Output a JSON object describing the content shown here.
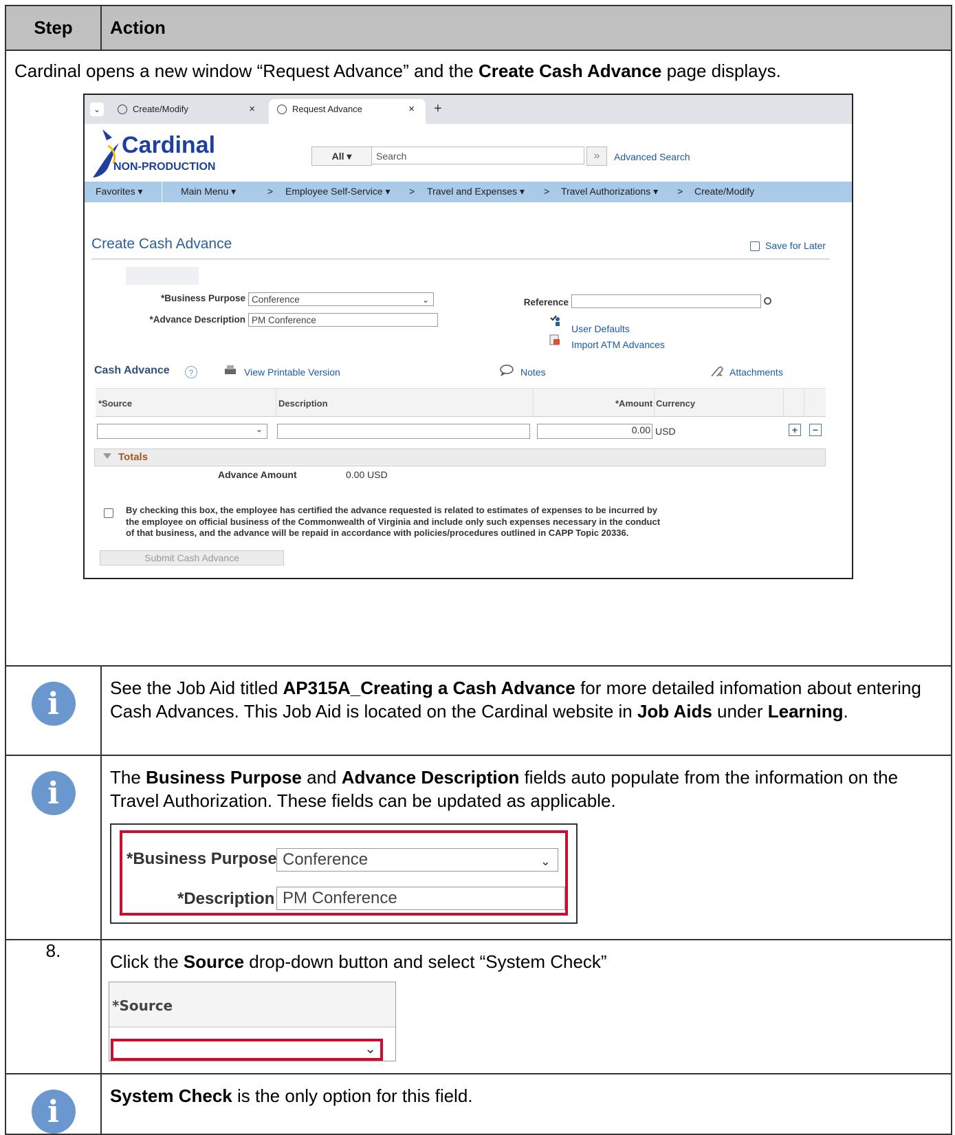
{
  "table": {
    "header_step": "Step",
    "header_action": "Action"
  },
  "intro": {
    "text_1": "Cardinal opens a new window “Request Advance” and the ",
    "bold_1": "Create Cash Advance",
    "text_2": " page displays."
  },
  "browser": {
    "tab_1": "Create/Modify",
    "tab_2": "Request Advance",
    "tab_close": "×",
    "new_tab": "+",
    "logo_main": "Cardinal",
    "logo_sub": "NON-PRODUCTION",
    "search_scope": "All",
    "search_placeholder": "Search",
    "advanced_search": "Advanced Search",
    "nav": {
      "favorites": "Favorites ▾",
      "main_menu": "Main Menu ▾",
      "employee_self_service": "Employee Self-Service ▾",
      "travel_expenses": "Travel and Expenses ▾",
      "travel_authorizations": "Travel Authorizations ▾",
      "create_modify": "Create/Modify",
      "separator": ">"
    }
  },
  "form": {
    "page_title": "Create Cash Advance",
    "save_for_later": "Save for Later",
    "business_purpose_label": "*Business Purpose",
    "business_purpose_value": "Conference",
    "advance_description_label": "*Advance Description",
    "advance_description_value": "PM Conference",
    "reference_label": "Reference",
    "reference_value": "",
    "user_defaults": "User Defaults",
    "import_atm": "Import ATM Advances",
    "section_title": "Cash Advance",
    "help": "?",
    "view_printable": "View Printable Version",
    "notes": "Notes",
    "attachments": "Attachments",
    "grid": {
      "col_source": "*Source",
      "col_description": "Description",
      "col_amount": "*Amount",
      "col_currency": "Currency",
      "row_amount": "0.00",
      "row_currency": "USD",
      "add": "+",
      "remove": "−"
    },
    "totals_label": "Totals",
    "advance_amount_label": "Advance Amount",
    "advance_amount_value": "0.00  USD",
    "certify_text": "By checking this box, the employee has certified the advance requested is related to estimates of expenses to be incurred by the employee on official business of the Commonwealth of Virginia and include only such expenses necessary in the conduct of that business, and the advance will be repaid in accordance with policies/procedures outlined in CAPP Topic 20336.",
    "submit": "Submit Cash Advance"
  },
  "tip1": {
    "t1": "See the Job Aid titled ",
    "b1": "AP315A_Creating a Cash Advance",
    "t2": " for more detailed infomation about entering Cash Advances.  This Job Aid is located on the Cardinal website in ",
    "b2": "Job Aids",
    "t3": " under ",
    "b3": "Learning",
    "t4": "."
  },
  "tip2": {
    "t1": "The ",
    "b1": "Business Purpose",
    "t2": " and ",
    "b2": "Advance Description",
    "t3": " fields auto populate from the information on the Travel Authorization.  These fields can be updated as applicable.",
    "zoom_purpose_label": "*Business Purpose",
    "zoom_purpose_value": "Conference",
    "zoom_description_label": "*Description",
    "zoom_description_value": "PM Conference"
  },
  "step8": {
    "number": "8.",
    "t1": "Click the ",
    "b1": "Source",
    "t2": " drop-down button and select “System Check”",
    "zoom_label": "*Source"
  },
  "tip3": {
    "b1": "System Check",
    "t1": " is the only option for this field."
  },
  "icons": {
    "info": "i",
    "chevron_down": "⌄"
  },
  "colors": {
    "header_bg": "#c0c0c0",
    "info_icon": "#6b97cf",
    "nav_bar": "#a9cae8",
    "highlight_red": "#c8102e",
    "link_blue": "#1a5aa8"
  }
}
